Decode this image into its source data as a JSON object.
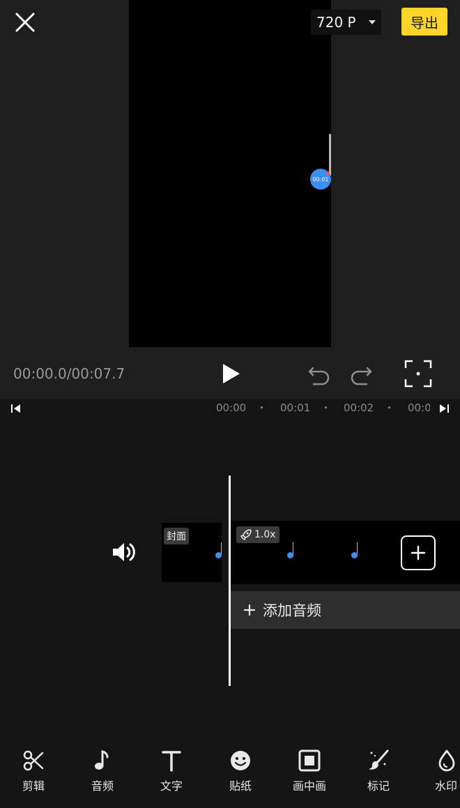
{
  "header": {
    "resolution": "720 P",
    "export_label": "导出"
  },
  "preview": {
    "marker_time": "00:01"
  },
  "playback": {
    "time": "00:00.0/00:07.7"
  },
  "ruler": {
    "ticks": [
      "00:00",
      "00:01",
      "00:02",
      "00:0"
    ]
  },
  "timeline": {
    "cover_label": "封面",
    "speed": "1.0x",
    "add_audio": "添加音频"
  },
  "toolbar": {
    "items": [
      {
        "label": "剪辑",
        "icon": "scissors-icon"
      },
      {
        "label": "音频",
        "icon": "music-note-icon"
      },
      {
        "label": "文字",
        "icon": "text-icon"
      },
      {
        "label": "贴纸",
        "icon": "smiley-icon"
      },
      {
        "label": "画中画",
        "icon": "picture-in-picture-icon"
      },
      {
        "label": "标记",
        "icon": "brush-icon"
      },
      {
        "label": "水印",
        "icon": "droplet-icon"
      }
    ]
  },
  "colors": {
    "accent": "#fdd42a",
    "keyframe": "#3d8ef0",
    "background": "#141414"
  }
}
